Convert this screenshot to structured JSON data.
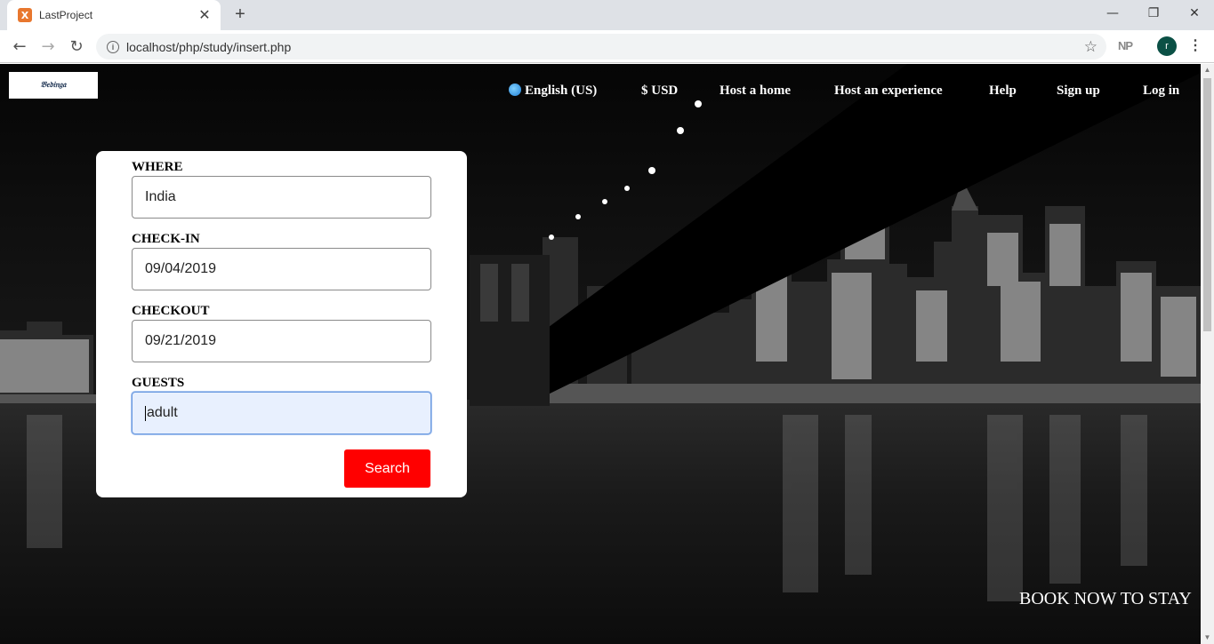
{
  "browser": {
    "tab_title": "LastProject",
    "favicon_glyph": "X",
    "tab_close": "✕",
    "new_tab": "+",
    "url": "localhost/php/study/insert.php",
    "extension_label": "NP",
    "profile_initial": "r",
    "window_minimize": "—",
    "window_restore": "❐",
    "window_close": "✕",
    "back_icon": "←",
    "forward_icon": "→",
    "reload_icon": "↻",
    "info_icon": "i",
    "star_icon": "☆",
    "menu_icon": "⋮"
  },
  "site": {
    "logo_text": "𝔅𝔢𝔡𝔦𝔫𝔤𝔞",
    "nav": {
      "language": "English (US)",
      "currency": "$ USD",
      "host_home": "Host a home",
      "host_experience": "Host an experience",
      "help": "Help",
      "sign_up": "Sign up",
      "log_in": "Log in"
    },
    "form": {
      "where_label": "WHERE",
      "where_value": "India",
      "checkin_label": "CHECK-IN",
      "checkin_value": "09/04/2019",
      "checkout_label": "CHECKOUT",
      "checkout_value": "09/21/2019",
      "guests_label": "GUESTS",
      "guests_value": "adult",
      "search_button": "Search"
    },
    "banner_text": "BOOK NOW TO STAY"
  },
  "colors": {
    "search_button": "#ff0000",
    "profile_avatar": "#0b5045",
    "focused_input_bg": "#e8f0fe"
  }
}
